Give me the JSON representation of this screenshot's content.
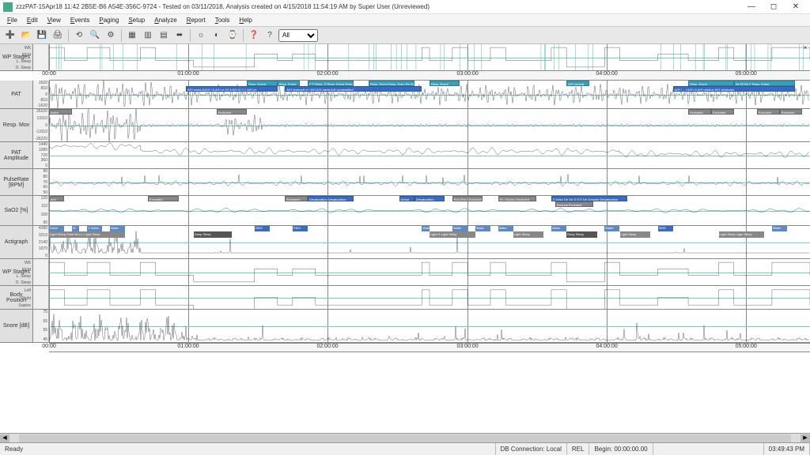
{
  "window": {
    "title": "zzzPAT-15Apr18 11:42 2B5E-B6 A54E-356C-9724 - Tested on 03/11/2018, Analysis created on 4/15/2018 11:54:19 AM by Super User (Unreviewed)",
    "min": "—",
    "max": "◻",
    "close": "✕"
  },
  "menu": {
    "items": [
      "File",
      "Edit",
      "View",
      "Events",
      "Paging",
      "Setup",
      "Analyze",
      "Report",
      "Tools",
      "Help"
    ]
  },
  "toolbar": {
    "icons": [
      "➕",
      "📂",
      "💾",
      "🖨",
      "⟲",
      "🔍",
      "⚙",
      "▦",
      "▥",
      "▤",
      "⬌",
      "☼",
      "◐",
      "⌚",
      "❓",
      "?"
    ],
    "dropdown_value": "All"
  },
  "timeaxis": {
    "ticks": [
      "00:00",
      "01:00:00",
      "02:00:00",
      "03:00:00",
      "04:00:00",
      "05:00:00"
    ]
  },
  "channels": [
    {
      "id": "wp-stages-top",
      "label": "WP Stages",
      "subs": [
        "WK",
        "REM",
        "L. Sleep",
        "D. Sleep"
      ],
      "scale": [],
      "h": 34,
      "type": "staircase",
      "close": true
    },
    {
      "id": "pat",
      "label": "PAT",
      "scale": [
        "1620",
        "810",
        "0",
        "-810",
        "-1620"
      ],
      "h": 36,
      "type": "dense",
      "events": [
        {
          "l": 26,
          "w": 4,
          "t": "Resp. Event",
          "c": "cyan"
        },
        {
          "l": 30,
          "w": 3,
          "t": "Resp. Event",
          "c": "cyan"
        },
        {
          "l": 34,
          "w": 6,
          "t": "F F Resp. E Resp. Event Resp. Resp. Event",
          "c": "cyan"
        },
        {
          "l": 42,
          "w": 6,
          "t": "Resp. Event Resp. Even Re Resp. Event",
          "c": "cyan"
        },
        {
          "l": 50,
          "w": 4,
          "t": "Resp. Event",
          "c": "cyan"
        },
        {
          "l": 68,
          "w": 3,
          "t": "A/H central",
          "c": "cyan"
        },
        {
          "l": 84,
          "w": 6,
          "t": "Resp. Event",
          "c": "cyan"
        },
        {
          "l": 90,
          "w": 8,
          "t": "Re Ri Re F Resp. Event",
          "c": "cyan"
        },
        {
          "l": 18,
          "w": 12,
          "t": "A/H uncla A/A/H i A A/H ur A/I A A/H A/ I I I A/H un",
          "c": "blue",
          "row": 1
        },
        {
          "l": 31,
          "w": 18,
          "t": "A/H obstructi vi I A/H A/H uncla A/H unclassified",
          "c": "blue",
          "row": 1
        },
        {
          "l": 82,
          "w": 16,
          "t": "A/H i ... i A/H i A A/H obstruc A/H obstructiv",
          "c": "blue",
          "row": 1
        }
      ]
    },
    {
      "id": "resp-mov",
      "label": "Resp. Mov",
      "scale": [
        "26220",
        "13110",
        "0",
        "-13110",
        "-26220"
      ],
      "h": 42,
      "type": "resp",
      "events": [
        {
          "l": 0,
          "w": 3,
          "t": "luded",
          "c": "gray"
        },
        {
          "l": 22,
          "w": 4,
          "t": "Excluded",
          "c": "gray"
        },
        {
          "l": 84,
          "w": 3,
          "t": "Excluded",
          "c": "gray"
        },
        {
          "l": 87,
          "w": 3,
          "t": "Excluded",
          "c": "gray"
        },
        {
          "l": 93,
          "w": 3,
          "t": "Excluded",
          "c": "gray"
        },
        {
          "l": 96,
          "w": 3,
          "t": "Excluded",
          "c": "gray"
        }
      ]
    },
    {
      "id": "pat-amp",
      "label": "PAT Amplitude",
      "scale": [
        "1440",
        "1080",
        "720",
        "360",
        "0"
      ],
      "h": 34,
      "type": "amp"
    },
    {
      "id": "pulse",
      "label": "PulseRate [BPM]",
      "scale": [
        "90",
        "80",
        "70",
        "60",
        "50"
      ],
      "h": 34,
      "type": "pulse"
    },
    {
      "id": "sao2",
      "label": "SaO2 [%]",
      "scale": [
        "120",
        "110",
        "100",
        "90"
      ],
      "h": 38,
      "type": "sao2",
      "events": [
        {
          "l": 0,
          "w": 2,
          "t": "ded",
          "c": "gray"
        },
        {
          "l": 13,
          "w": 4,
          "t": "Excluded",
          "c": "gray"
        },
        {
          "l": 31,
          "w": 3,
          "t": "Excluded",
          "c": "gray"
        },
        {
          "l": 34,
          "w": 6,
          "t": "Desaturation Desaturation",
          "c": "blue"
        },
        {
          "l": 46,
          "w": 2,
          "t": "Desat",
          "c": "blue"
        },
        {
          "l": 48,
          "w": 4,
          "t": "Desaturation",
          "c": "blue"
        },
        {
          "l": 53,
          "w": 4,
          "t": "Excl Exc I Excluded",
          "c": "gray"
        },
        {
          "l": 59,
          "w": 5,
          "t": "Ex I Excluc Excluded",
          "c": "gray"
        },
        {
          "l": 66,
          "w": 10,
          "t": "D Desc De De D E E De Desatur Desaturation",
          "c": "blue"
        },
        {
          "l": 66.5,
          "w": 5,
          "t": "Exclude Excluded",
          "c": "gray",
          "row": 1
        }
      ]
    },
    {
      "id": "actigraph",
      "label": "Actigraph",
      "scale": [
        "4280",
        "3210",
        "2140",
        "1070",
        "0"
      ],
      "h": 42,
      "type": "acti",
      "sleepstages": [
        {
          "l": 0,
          "w": 2,
          "s": "wake",
          "t": "Wake"
        },
        {
          "l": 3,
          "w": 1,
          "s": "wake",
          "t": "W"
        },
        {
          "l": 5,
          "w": 2,
          "s": "wake",
          "t": "V Wake"
        },
        {
          "l": 8,
          "w": 2,
          "s": "wake",
          "t": "Wake"
        },
        {
          "l": 0,
          "w": 10,
          "s": "light",
          "t": "Light Sleep  Push Bi Li L Light Sleep",
          "row": 1
        },
        {
          "l": 19,
          "w": 5,
          "s": "deep",
          "t": "Deep Sleep",
          "row": 1
        },
        {
          "l": 27,
          "w": 2,
          "s": "rem",
          "t": "REM"
        },
        {
          "l": 32,
          "w": 2,
          "s": "rem",
          "t": "REM"
        },
        {
          "l": 49,
          "w": 1,
          "s": "wake",
          "t": "Wake"
        },
        {
          "l": 50,
          "w": 6,
          "s": "light",
          "t": "Light S Light Sleep",
          "row": 1
        },
        {
          "l": 53,
          "w": 2,
          "s": "wake",
          "t": "Wake"
        },
        {
          "l": 56,
          "w": 2,
          "s": "wake",
          "t": "Wake"
        },
        {
          "l": 59,
          "w": 2,
          "s": "wake",
          "t": "Wake"
        },
        {
          "l": 61,
          "w": 4,
          "s": "light",
          "t": "Light Sleep",
          "row": 1
        },
        {
          "l": 66,
          "w": 2,
          "s": "wake",
          "t": "Wake"
        },
        {
          "l": 68,
          "w": 4,
          "s": "deep",
          "t": "Deep Sleep",
          "row": 1
        },
        {
          "l": 73,
          "w": 2,
          "s": "wake",
          "t": "Wake"
        },
        {
          "l": 75,
          "w": 4,
          "s": "light",
          "t": "Light Sleep",
          "row": 1
        },
        {
          "l": 80,
          "w": 2,
          "s": "rem",
          "t": "REM"
        },
        {
          "l": 88,
          "w": 6,
          "s": "light",
          "t": "Light Sleep  Light Sleep",
          "row": 1
        },
        {
          "l": 95,
          "w": 2,
          "s": "wake",
          "t": "Wake"
        }
      ]
    },
    {
      "id": "wp-stages-bot",
      "label": "WP Stages",
      "subs": [
        "WK",
        "REM",
        "L. Sleep",
        "D. Sleep"
      ],
      "scale": [],
      "h": 34,
      "type": "staircase"
    },
    {
      "id": "body-pos",
      "label": "Body Position",
      "subs": [
        "Left",
        "Right",
        "Supine"
      ],
      "scale": [],
      "h": 30,
      "type": "staircase2"
    },
    {
      "id": "snore",
      "label": "Snore [dB]",
      "scale": [
        "75",
        "65",
        "55",
        "45"
      ],
      "h": 42,
      "type": "snore"
    }
  ],
  "status": {
    "ready": "Ready",
    "db": "DB Connection: Local",
    "rel": "REL",
    "begin": "Begin: 00:00:00.00",
    "clock": "03:49:43 PM"
  }
}
